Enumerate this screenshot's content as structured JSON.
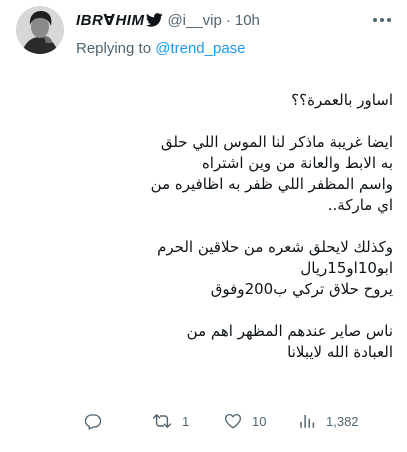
{
  "tweet": {
    "display_name": "IBR∀HIM",
    "handle": "@i__vip",
    "separator": "·",
    "time": "10h",
    "reply_prefix": "Replying to",
    "reply_to": "@trend_pase",
    "body": {
      "p1": "اساور بالعمرة؟؟",
      "p2": "ايضا غريبة ماذكر لنا الموس اللي حلق\nبه الابط والعانة من وين اشتراه\nواسم المظفر اللي ظفر به اظافيره من\nاي ماركة..",
      "p3": "وكذلك لايحلق شعره من حلاقين الحرم\nابو10او15ريال\nيروح حلاق تركي ب200وفوق",
      "p4": "ناس صاير عندهم المظهر اهم من\nالعبادة الله لايبلانا"
    },
    "stats": {
      "replies": "",
      "retweets": "1",
      "likes": "10",
      "views": "1,382"
    }
  },
  "icons": {
    "platform": "bird-icon",
    "more": "more-icon",
    "reply": "reply-icon",
    "retweet": "retweet-icon",
    "like": "heart-icon",
    "views": "views-icon"
  },
  "colors": {
    "accent": "#1d9bf0",
    "secondary_text": "#536471",
    "primary_text": "#0f1419"
  }
}
